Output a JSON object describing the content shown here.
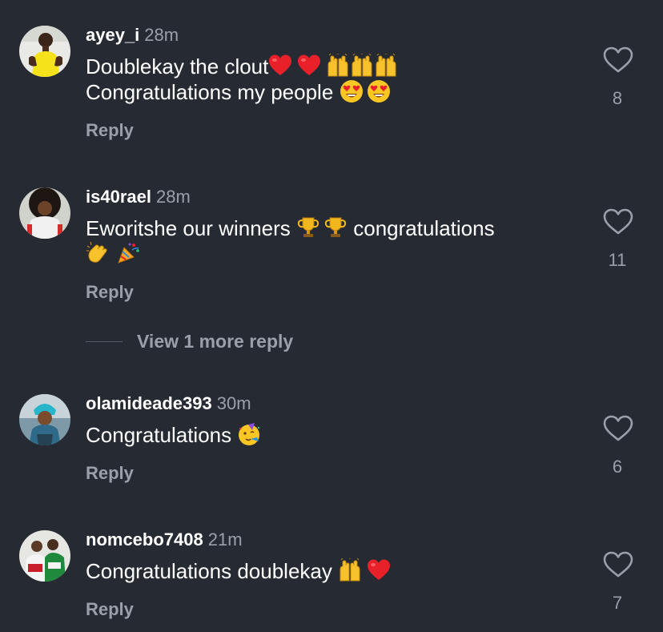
{
  "colors": {
    "background": "#262a33",
    "primary_text": "#ffffff",
    "secondary_text": "#9aa0aa",
    "heart_emoji": "#e8202a",
    "hands_emoji": "#f7c22c"
  },
  "comments": [
    {
      "username": "ayey_i",
      "time": "28m",
      "line1": "Doublekay the clout",
      "line2": "Congratulations my people",
      "reply_label": "Reply",
      "like_count": "8",
      "like_icon": "heart-outline-icon"
    },
    {
      "username": "is40rael",
      "time": "28m",
      "line1a": "Eworitshe our winners",
      "line1b": "congratulations",
      "reply_label": "Reply",
      "like_count": "11",
      "like_icon": "heart-outline-icon"
    },
    {
      "username": "olamideade393",
      "time": "30m",
      "line1": "Congratulations",
      "reply_label": "Reply",
      "like_count": "6",
      "like_icon": "heart-outline-icon"
    },
    {
      "username": "nomcebo7408",
      "time": "21m",
      "line1": "Congratulations doublekay",
      "reply_label": "Reply",
      "like_count": "7",
      "like_icon": "heart-outline-icon"
    }
  ],
  "more_replies": {
    "label": "View 1 more reply"
  }
}
